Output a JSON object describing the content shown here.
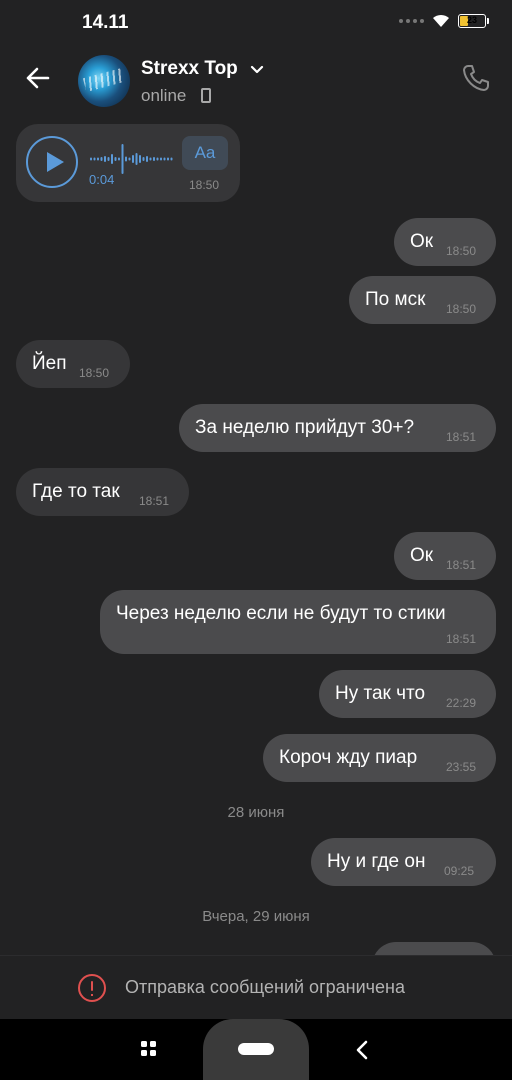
{
  "status_bar": {
    "time": "14.11",
    "battery": "23"
  },
  "header": {
    "contact_name": "Strexx Top",
    "status": "online"
  },
  "voice_message": {
    "duration": "0:04",
    "transcribe_label": "Aa",
    "time": "18:50"
  },
  "messages": [
    {
      "dir": "out",
      "text": "Ок",
      "time": "18:50"
    },
    {
      "dir": "out",
      "text": "По мск",
      "time": "18:50"
    },
    {
      "dir": "in",
      "text": "Йеп",
      "time": "18:50"
    },
    {
      "dir": "out",
      "text": "За неделю прийдут 30+?",
      "time": "18:51"
    },
    {
      "dir": "in",
      "text": "Где то так",
      "time": "18:51"
    },
    {
      "dir": "out",
      "text": "Ок",
      "time": "18:51"
    },
    {
      "dir": "out",
      "text": "Через неделю если не будут то стики",
      "time": "18:51"
    },
    {
      "dir": "out",
      "text": "Ну так что",
      "time": "22:29"
    },
    {
      "dir": "out",
      "text": "Короч жду пиар",
      "time": "23:55"
    },
    {
      "dir": "out",
      "text": "Ну и где он",
      "time": "09:25"
    }
  ],
  "date_separators": [
    "28 июня",
    "Вчера, 29 июня"
  ],
  "restriction": {
    "text": "Отправка сообщений ограничена"
  },
  "colors": {
    "accent": "#5b9ad9",
    "alert": "#e0504f",
    "incoming_bubble": "#363638",
    "outgoing_bubble": "#4b4b4d",
    "background": "#222223"
  }
}
